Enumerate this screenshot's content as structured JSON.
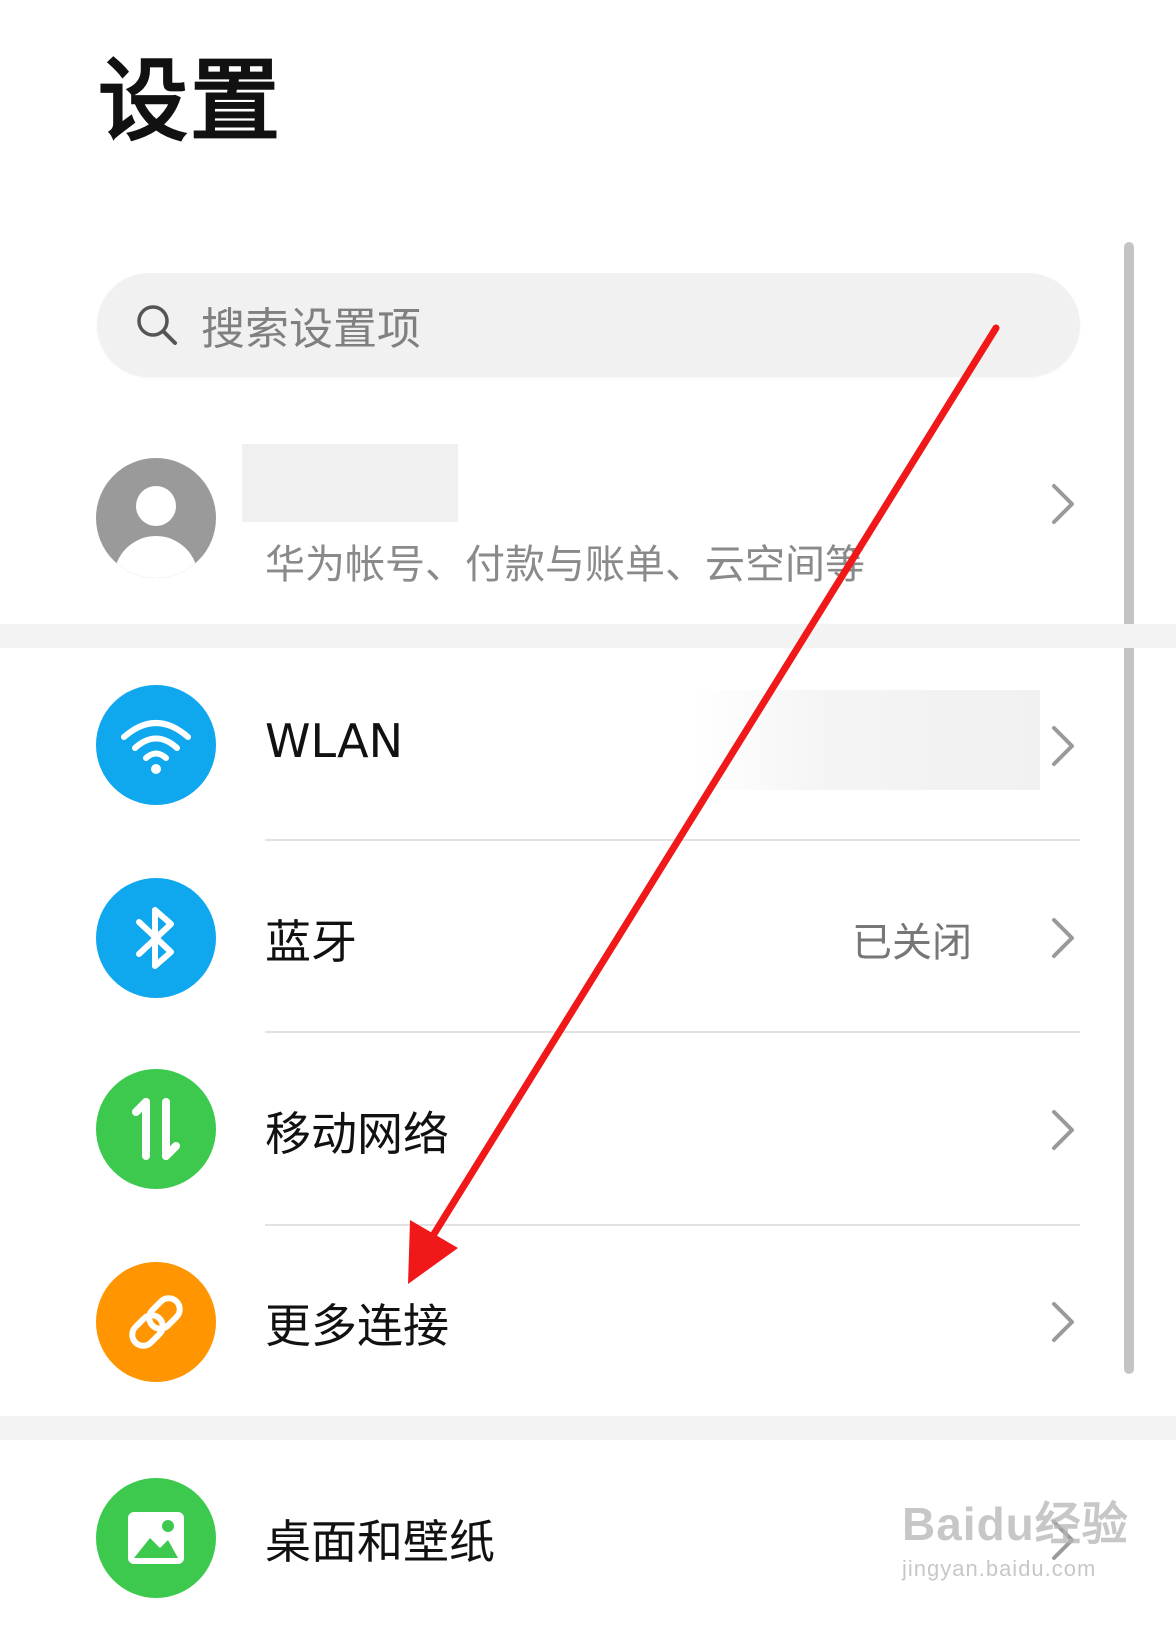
{
  "page": {
    "title": "设置"
  },
  "search": {
    "placeholder": "搜索设置项"
  },
  "account": {
    "subtitle": "华为帐号、付款与账单、云空间等"
  },
  "connectivity": [
    {
      "label": "WLAN",
      "value": "",
      "icon": "wifi-icon",
      "color": "#0fa7ee"
    },
    {
      "label": "蓝牙",
      "value": "已关闭",
      "icon": "bluetooth-icon",
      "color": "#0fa7ee"
    },
    {
      "label": "移动网络",
      "value": "",
      "icon": "mobile-data-icon",
      "color": "#3cc94e"
    },
    {
      "label": "更多连接",
      "value": "",
      "icon": "link-icon",
      "color": "#ff9500"
    }
  ],
  "display": [
    {
      "label": "桌面和壁纸",
      "icon": "wallpaper-icon",
      "color": "#3cc94e"
    }
  ],
  "watermark": {
    "logo": "Baidu经验",
    "url": "jingyan.baidu.com"
  },
  "colors": {
    "annotation_arrow": "#f01818",
    "chevron": "#9a9a9a"
  }
}
